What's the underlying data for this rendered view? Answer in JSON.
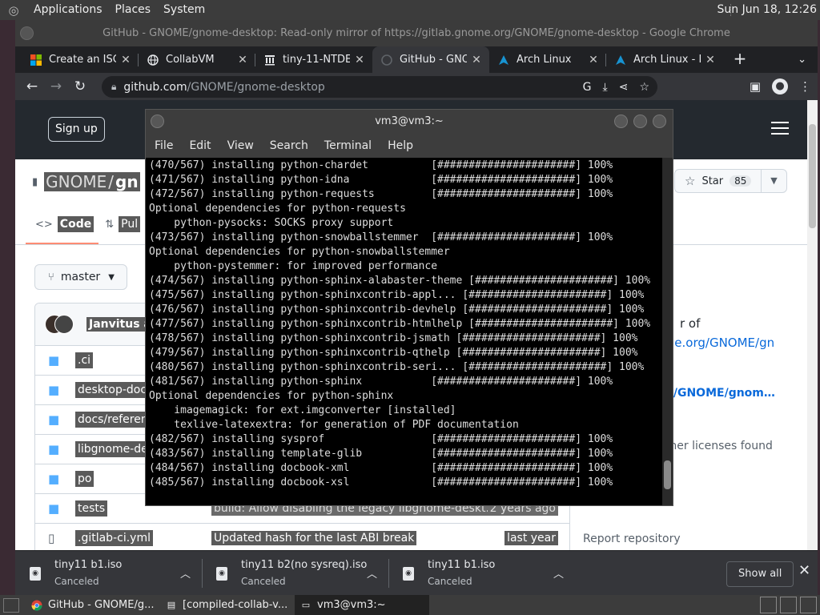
{
  "panel": {
    "menus": [
      "Applications",
      "Places",
      "System"
    ],
    "clock": "Sun Jun 18, 12:26"
  },
  "chrome": {
    "window_title": "GitHub - GNOME/gnome-desktop: Read-only mirror of https://gitlab.gnome.org/GNOME/gnome-desktop - Google Chrome",
    "tabs": [
      {
        "label": "Create an ISO",
        "icon": "windows-logo-icon"
      },
      {
        "label": "CollabVM",
        "icon": "globe-icon"
      },
      {
        "label": "tiny-11-NTDE",
        "icon": "archive-org-icon"
      },
      {
        "label": "GitHub - GNO",
        "icon": "github-icon"
      },
      {
        "label": "Arch Linux",
        "icon": "arch-linux-icon"
      },
      {
        "label": "Arch Linux - D",
        "icon": "arch-linux-icon"
      }
    ],
    "url_host": "github.com",
    "url_path": "/GNOME/gnome-desktop"
  },
  "github": {
    "signup": "Sign up",
    "owner": "GNOME",
    "slash": "/",
    "repo_short": "gn",
    "star_label": "Star",
    "star_count": "85",
    "tabs": [
      {
        "label": "Code",
        "icon": "code-icon"
      },
      {
        "label": "Pul",
        "icon": "pull-request-icon"
      }
    ],
    "branch": "master",
    "commit_author": "Janvitus ar",
    "files": [
      {
        "name": ".ci",
        "type": "dir",
        "msg": "",
        "date": ""
      },
      {
        "name": "desktop-docs",
        "type": "dir",
        "msg": "",
        "date": ""
      },
      {
        "name": "docs/reference",
        "type": "dir",
        "msg": "",
        "date": ""
      },
      {
        "name": "libgnome-desk",
        "type": "dir",
        "msg": "",
        "date": ""
      },
      {
        "name": "po",
        "type": "dir",
        "msg": "",
        "date": ""
      },
      {
        "name": "tests",
        "type": "dir",
        "msg": "build: Allow disabling the legacy libgnome-deskt...",
        "date": "2 years ago"
      },
      {
        "name": ".gitlab-ci.yml",
        "type": "file",
        "msg": "Updated hash for the last ABI break",
        "date": "last year"
      }
    ],
    "about_line1": "r of",
    "about_line2": "nome.org/GNOME/gn",
    "about_line3": ".org/GNOME/gnom…",
    "about_line4": "2 other licenses found",
    "report": "Report repository"
  },
  "downloads": {
    "items": [
      {
        "name": "tiny11 b1.iso",
        "status": "Canceled"
      },
      {
        "name": "tiny11 b2(no sysreq).iso",
        "status": "Canceled"
      },
      {
        "name": "tiny11 b1.iso",
        "status": "Canceled"
      }
    ],
    "show_all": "Show all"
  },
  "terminal": {
    "title": "vm3@vm3:~",
    "menus": [
      "File",
      "Edit",
      "View",
      "Search",
      "Terminal",
      "Help"
    ],
    "lines": [
      "(470/567) installing python-chardet          [######################] 100%",
      "(471/567) installing python-idna             [######################] 100%",
      "(472/567) installing python-requests         [######################] 100%",
      "Optional dependencies for python-requests",
      "    python-pysocks: SOCKS proxy support",
      "(473/567) installing python-snowballstemmer  [######################] 100%",
      "Optional dependencies for python-snowballstemmer",
      "    python-pystemmer: for improved performance",
      "(474/567) installing python-sphinx-alabaster-theme [######################] 100%",
      "(475/567) installing python-sphinxcontrib-appl... [######################] 100%",
      "(476/567) installing python-sphinxcontrib-devhelp [######################] 100%",
      "(477/567) installing python-sphinxcontrib-htmlhelp [######################] 100%",
      "(478/567) installing python-sphinxcontrib-jsmath [######################] 100%",
      "(479/567) installing python-sphinxcontrib-qthelp [######################] 100%",
      "(480/567) installing python-sphinxcontrib-seri... [######################] 100%",
      "(481/567) installing python-sphinx           [######################] 100%",
      "Optional dependencies for python-sphinx",
      "    imagemagick: for ext.imgconverter [installed]",
      "    texlive-latexextra: for generation of PDF documentation",
      "(482/567) installing sysprof                 [######################] 100%",
      "(483/567) installing template-glib           [######################] 100%",
      "(484/567) installing docbook-xml             [######################] 100%",
      "(485/567) installing docbook-xsl             [######################] 100%"
    ]
  },
  "taskbar": {
    "tasks": [
      {
        "label": "GitHub - GNOME/g...",
        "icon": "chrome-icon"
      },
      {
        "label": "[compiled-collab-v...",
        "icon": "collabvm-icon"
      },
      {
        "label": "vm3@vm3:~",
        "icon": "terminal-icon"
      }
    ]
  }
}
